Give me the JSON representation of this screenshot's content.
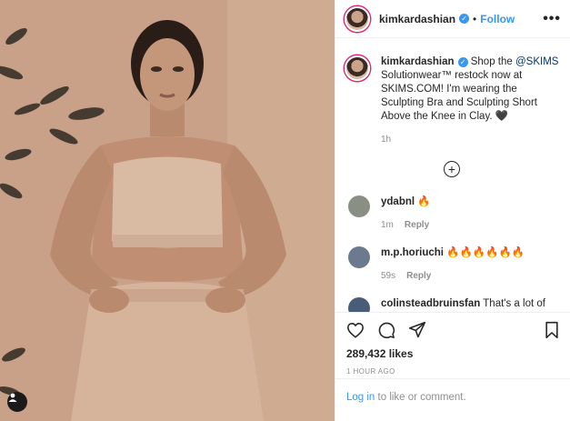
{
  "post": {
    "username": "kimkardashian",
    "follow_label": "Follow",
    "more_glyph": "•••",
    "verified_glyph": "✓"
  },
  "caption": {
    "username": "kimkardashian",
    "text_before_mention": " Shop the ",
    "mention": "@SKIMS",
    "text_after_mention": " Solutionwear™ restock now at SKIMS.COM! I'm wearing the Sculpting Bra and Sculpting Short Above the Knee in Clay. 🖤",
    "time": "1h"
  },
  "load_more_glyph": "+",
  "comments": [
    {
      "username": "ydabnl",
      "text": "🔥",
      "time": "1m",
      "reply_label": "Reply",
      "avatar_color": "#8a8f86"
    },
    {
      "username": "m.p.horiuchi",
      "text": "🔥🔥🔥🔥🔥🔥",
      "time": "59s",
      "reply_label": "Reply",
      "avatar_color": "#6b7a8c"
    },
    {
      "username": "colinsteadbruinsfan",
      "text": "That's a lot of air brushing",
      "time": "",
      "reply_label": "",
      "avatar_color": "#4a5d78"
    }
  ],
  "engagement": {
    "likes": "289,432 likes",
    "time_ago": "1 HOUR AGO"
  },
  "login_prompt": {
    "link": "Log in",
    "text": " to like or comment."
  },
  "colors": {
    "accent": "#3897f0",
    "text": "#262626",
    "muted": "#8e8e8e",
    "border": "#efefef"
  }
}
